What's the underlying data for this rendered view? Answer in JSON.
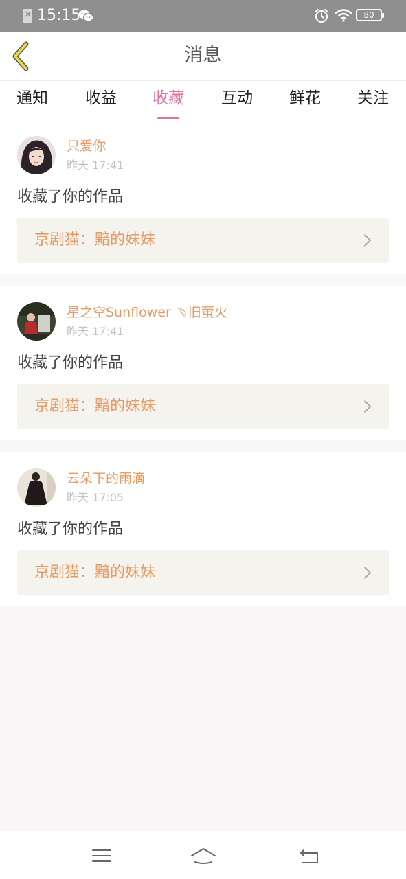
{
  "status_bar": {
    "time": "15:15",
    "battery": "80"
  },
  "header": {
    "title": "消息"
  },
  "tabs": [
    {
      "label": "通知"
    },
    {
      "label": "收益"
    },
    {
      "label": "收藏"
    },
    {
      "label": "互动"
    },
    {
      "label": "鲜花"
    },
    {
      "label": "关注"
    }
  ],
  "active_tab": "收藏",
  "messages": [
    {
      "user": "只爱你",
      "time": "昨天 17:41",
      "action": "收藏了你的作品",
      "work": "京剧猫：黯的妹妹"
    },
    {
      "user": "星之空Sunflower ﹆旧萤火",
      "time": "昨天 17:41",
      "action": "收藏了你的作品",
      "work": "京剧猫：黯的妹妹"
    },
    {
      "user": "云朵下的雨滴",
      "time": "昨天 17:05",
      "action": "收藏了你的作品",
      "work": "京剧猫：黯的妹妹"
    }
  ],
  "icons": {
    "back": "back-chevron-icon",
    "work_link": "chevron-right-icon",
    "nav_menu": "menu-icon",
    "nav_home": "home-icon",
    "nav_back": "return-icon"
  },
  "colors": {
    "accent_pink": "#e072a4",
    "name_orange": "#e89a63",
    "back_yellow": "#d9c43a",
    "work_bg": "#f4f3ee"
  }
}
